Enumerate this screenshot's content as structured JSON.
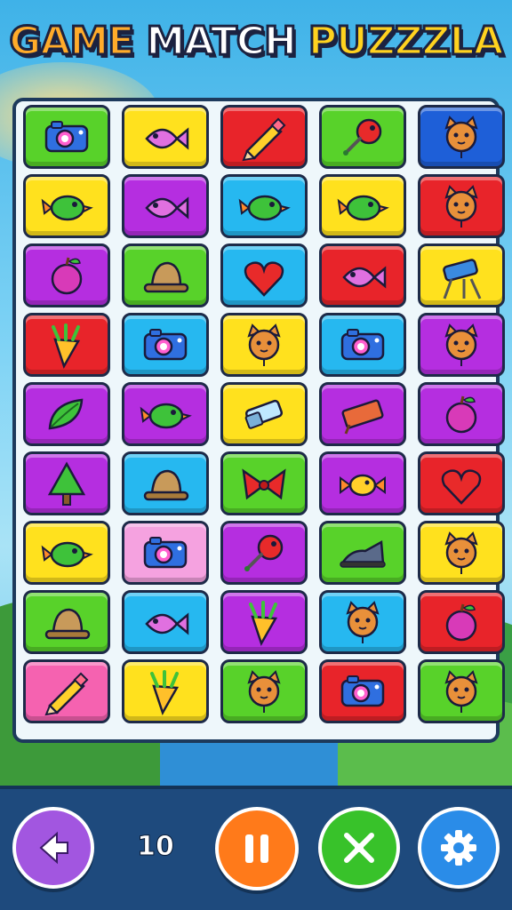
{
  "title": {
    "word1": "GAME",
    "word2": "MATCH",
    "word3": "PUZZZLA"
  },
  "toolbar": {
    "score": "10"
  },
  "buttons": [
    {
      "name": "back-button",
      "icon": "arrow-left-icon",
      "color": "#a256e0"
    },
    {
      "name": "pause-button",
      "icon": "pause-icon",
      "color": "#ff7a1a"
    },
    {
      "name": "shuffle-button",
      "icon": "shuffle-icon",
      "color": "#38c22a"
    },
    {
      "name": "settings-button",
      "icon": "gear-icon",
      "color": "#2a8ce8"
    }
  ],
  "board": {
    "rows": [
      [
        {
          "icon": "camera",
          "color": "#58d22a"
        },
        {
          "icon": "fish",
          "color": "#ffe11e"
        },
        {
          "icon": "pencil",
          "color": "#e8242a"
        },
        {
          "icon": "pin",
          "color": "#58d22a"
        },
        {
          "icon": "cat",
          "color": "#1e5fd8"
        }
      ],
      [
        {
          "icon": "bird",
          "color": "#ffe11e"
        },
        {
          "icon": "fish",
          "color": "#b52ee0"
        },
        {
          "icon": "bird",
          "color": "#26b8f0"
        },
        {
          "icon": "bird",
          "color": "#ffe11e"
        },
        {
          "icon": "cat",
          "color": "#e8242a"
        }
      ],
      [
        {
          "icon": "apple",
          "color": "#b52ee0"
        },
        {
          "icon": "hat",
          "color": "#58d22a"
        },
        {
          "icon": "heart",
          "color": "#26b8f0"
        },
        {
          "icon": "fish",
          "color": "#e8242a"
        },
        {
          "icon": "telescope",
          "color": "#ffe11e"
        }
      ],
      [
        {
          "icon": "carrot",
          "color": "#e8242a"
        },
        {
          "icon": "camera",
          "color": "#26b8f0"
        },
        {
          "icon": "cat",
          "color": "#ffe11e"
        },
        {
          "icon": "camera",
          "color": "#26b8f0"
        },
        {
          "icon": "cat",
          "color": "#b52ee0"
        }
      ],
      [
        {
          "icon": "leaf",
          "color": "#b52ee0"
        },
        {
          "icon": "bird",
          "color": "#b52ee0"
        },
        {
          "icon": "eraser",
          "color": "#ffe11e"
        },
        {
          "icon": "box",
          "color": "#b52ee0"
        },
        {
          "icon": "apple",
          "color": "#b52ee0"
        }
      ],
      [
        {
          "icon": "tree",
          "color": "#b52ee0"
        },
        {
          "icon": "hat",
          "color": "#26b8f0"
        },
        {
          "icon": "bow",
          "color": "#58d22a"
        },
        {
          "icon": "candy",
          "color": "#b52ee0"
        },
        {
          "icon": "heart",
          "color": "#e8242a"
        }
      ],
      [
        {
          "icon": "bird",
          "color": "#ffe11e"
        },
        {
          "icon": "camera",
          "color": "#f5a2e0"
        },
        {
          "icon": "pin",
          "color": "#b52ee0"
        },
        {
          "icon": "shoe",
          "color": "#58d22a"
        },
        {
          "icon": "cat",
          "color": "#ffe11e"
        }
      ],
      [
        {
          "icon": "hat",
          "color": "#58d22a"
        },
        {
          "icon": "fish",
          "color": "#26b8f0"
        },
        {
          "icon": "carrot",
          "color": "#b52ee0"
        },
        {
          "icon": "cat",
          "color": "#26b8f0"
        },
        {
          "icon": "apple",
          "color": "#e8242a"
        }
      ],
      [
        {
          "icon": "pencil",
          "color": "#f562b0"
        },
        {
          "icon": "carrot",
          "color": "#ffe11e"
        },
        {
          "icon": "cat",
          "color": "#58d22a"
        },
        {
          "icon": "camera",
          "color": "#e8242a"
        },
        {
          "icon": "cat",
          "color": "#58d22a"
        }
      ]
    ]
  }
}
